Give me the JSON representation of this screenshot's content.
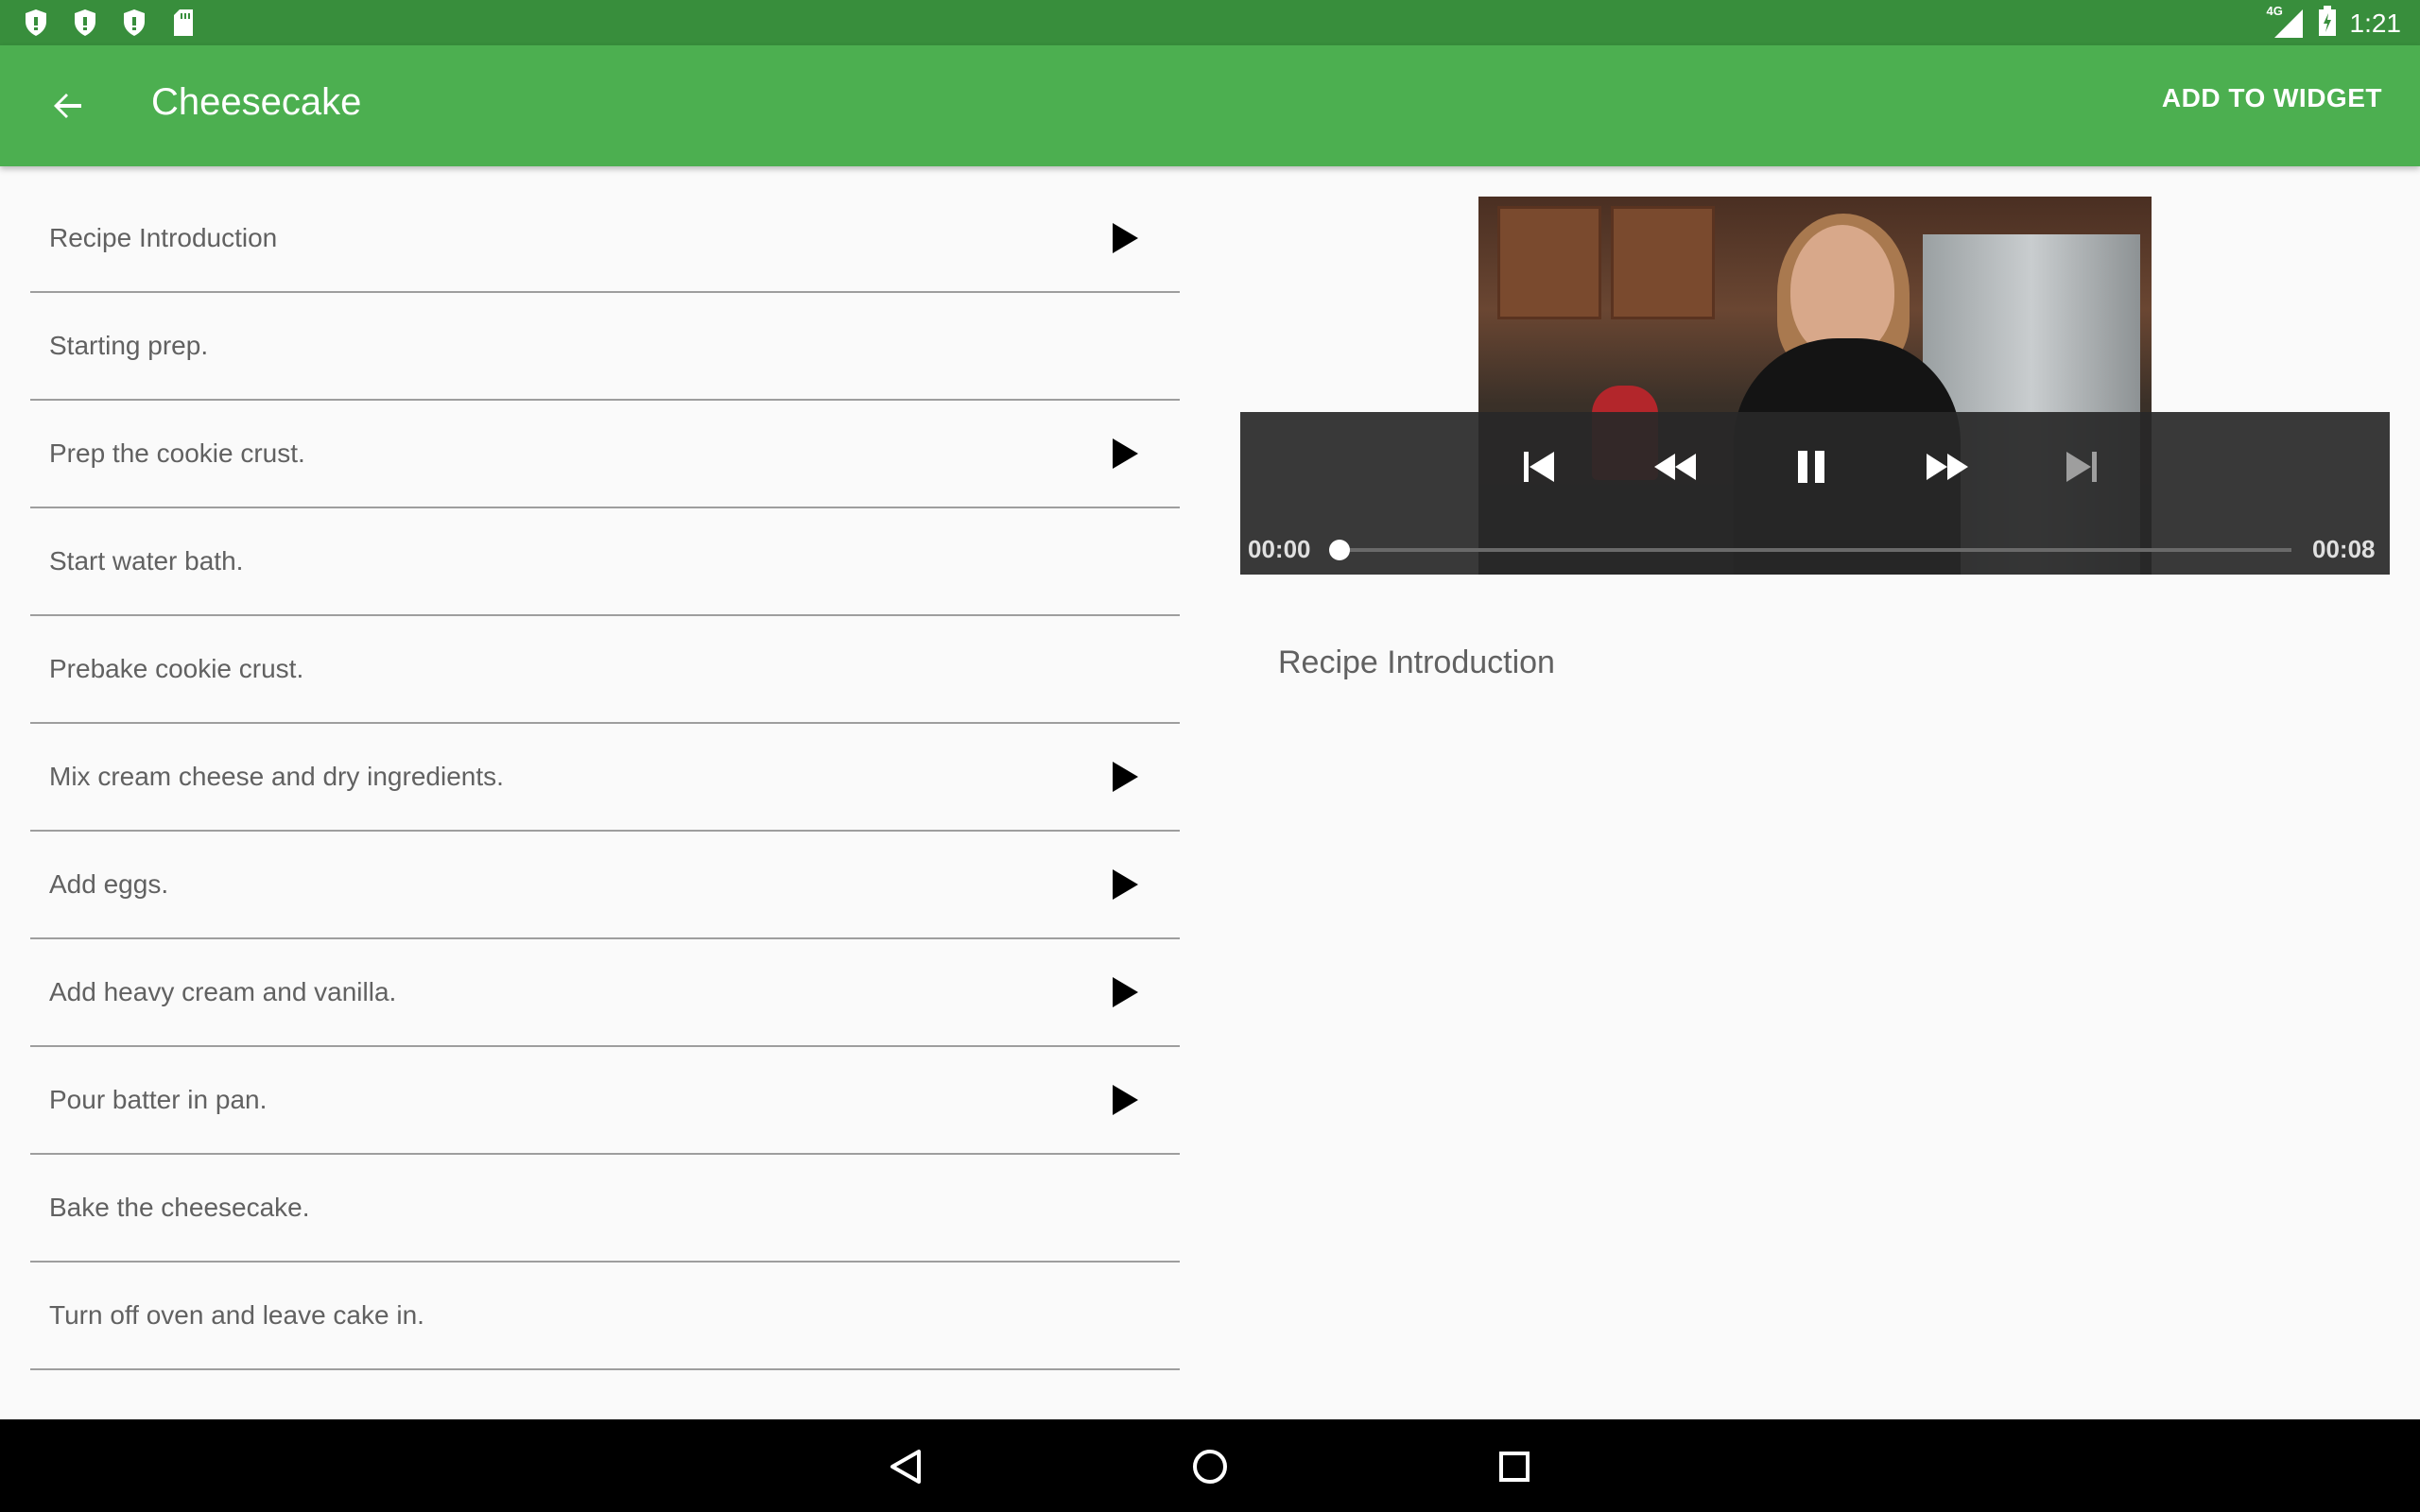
{
  "status_bar": {
    "time": "1:21",
    "network": "4G",
    "left_icons": [
      "shield-icon",
      "shield-icon",
      "shield-icon",
      "sd-card-icon"
    ],
    "right_icons": [
      "signal-icon",
      "battery-icon"
    ]
  },
  "app_bar": {
    "title": "Cheesecake",
    "action": "ADD TO WIDGET",
    "color": "#4caf50",
    "status_color": "#388e3c"
  },
  "steps": [
    {
      "label": "Recipe Introduction",
      "has_video": true
    },
    {
      "label": "Starting prep.",
      "has_video": false
    },
    {
      "label": "Prep the cookie crust.",
      "has_video": true
    },
    {
      "label": "Start water bath.",
      "has_video": false
    },
    {
      "label": "Prebake cookie crust.",
      "has_video": false
    },
    {
      "label": "Mix cream cheese and dry ingredients.",
      "has_video": true
    },
    {
      "label": "Add eggs.",
      "has_video": true
    },
    {
      "label": "Add heavy cream and vanilla.",
      "has_video": true
    },
    {
      "label": "Pour batter in pan.",
      "has_video": true
    },
    {
      "label": "Bake the cheesecake.",
      "has_video": false
    },
    {
      "label": "Turn off oven and leave cake in.",
      "has_video": false
    }
  ],
  "player": {
    "current_time": "00:00",
    "duration": "00:08",
    "progress": 0.0,
    "controls": [
      "skip-previous-icon",
      "rewind-icon",
      "pause-icon",
      "fast-forward-icon",
      "skip-next-icon"
    ]
  },
  "detail": {
    "description": "Recipe Introduction"
  },
  "nav_bar": {
    "buttons": [
      "back-triangle-icon",
      "home-circle-icon",
      "recents-square-icon"
    ]
  }
}
